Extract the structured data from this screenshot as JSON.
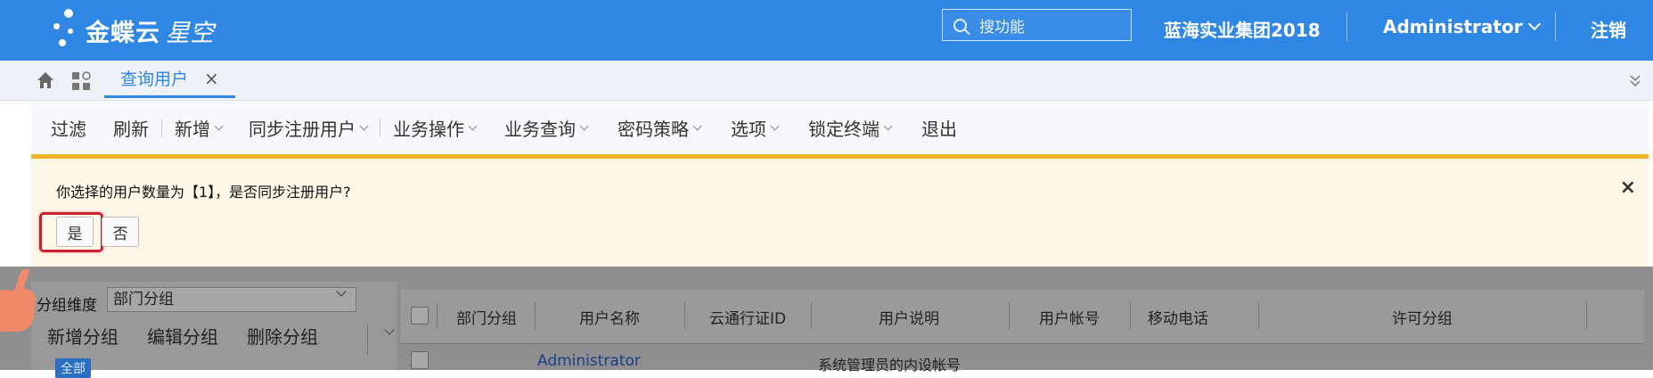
{
  "header": {
    "logo_brand": "金蝶云",
    "logo_product": "星空",
    "search_placeholder": "搜功能",
    "organization": "蓝海实业集团2018",
    "user": "Administrator",
    "logout": "注销"
  },
  "tabs": [
    {
      "label": "查询用户",
      "close": "×"
    }
  ],
  "toolbar": {
    "items": [
      "过滤",
      "刷新",
      "新增",
      "同步注册用户",
      "业务操作",
      "业务查询",
      "密码策略",
      "选项",
      "锁定终端",
      "退出"
    ]
  },
  "confirm": {
    "message": "你选择的用户数量为【1】，是否同步注册用户?",
    "yes": "是",
    "no": "否",
    "close": "×"
  },
  "group_panel": {
    "label": "分组维度",
    "selected": "部门分组",
    "buttons": [
      "新增分组",
      "编辑分组",
      "删除分组"
    ],
    "tag_all": "全部"
  },
  "grid": {
    "columns": [
      "部门分组",
      "用户名称",
      "云通行证ID",
      "用户说明",
      "用户帐号",
      "移动电话",
      "许可分组"
    ],
    "rows": [
      {
        "user_name": "Administrator",
        "description": "系统管理员的内设帐号"
      }
    ]
  },
  "colors": {
    "header_bg": "#2f86e3",
    "toolbar_accent": "#f0b323",
    "highlight": "#c82333"
  }
}
